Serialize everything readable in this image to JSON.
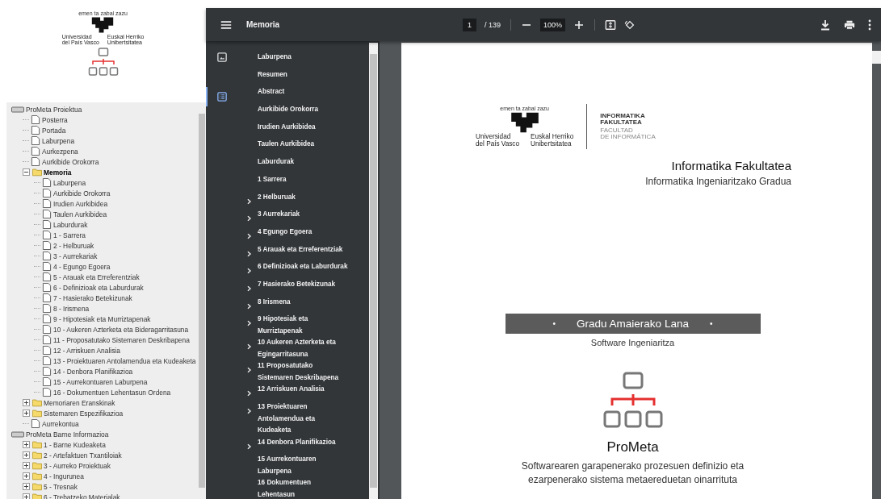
{
  "brand": {
    "motto": "emen ta zabal zazu",
    "name_es": [
      "Universidad",
      "del País Vasco"
    ],
    "name_eu": [
      "Euskal Herriko",
      "Unibertsitatea"
    ]
  },
  "tree": [
    {
      "kind": "drive",
      "label": "ProMeta Proiektua",
      "selected": false,
      "children": [
        {
          "kind": "doc",
          "label": "Posterra",
          "selected": false
        },
        {
          "kind": "doc",
          "label": "Portada",
          "selected": false
        },
        {
          "kind": "doc",
          "label": "Laburpena",
          "selected": false
        },
        {
          "kind": "doc",
          "label": "Aurkezpena",
          "selected": false
        },
        {
          "kind": "doc",
          "label": "Aurkibide Orokorra",
          "selected": false
        },
        {
          "kind": "folder",
          "label": "Memoria",
          "selected": true,
          "expanded": true,
          "children": [
            {
              "kind": "doc",
              "label": "Laburpena",
              "selected": false
            },
            {
              "kind": "doc",
              "label": "Aurkibide Orokorra",
              "selected": false
            },
            {
              "kind": "doc",
              "label": "Irudien Aurkibidea",
              "selected": false
            },
            {
              "kind": "doc",
              "label": "Taulen Aurkibidea",
              "selected": false
            },
            {
              "kind": "doc",
              "label": "Laburdurak",
              "selected": false
            },
            {
              "kind": "doc",
              "label": "1 - Sarrera",
              "selected": false
            },
            {
              "kind": "doc",
              "label": "2 - Helburuak",
              "selected": false
            },
            {
              "kind": "doc",
              "label": "3 - Aurrekariak",
              "selected": false
            },
            {
              "kind": "doc",
              "label": "4 - Egungo Egoera",
              "selected": false
            },
            {
              "kind": "doc",
              "label": "5 - Arauak eta Erreferentziak",
              "selected": false
            },
            {
              "kind": "doc",
              "label": "6 - Definizioak eta Laburdurak",
              "selected": false
            },
            {
              "kind": "doc",
              "label": "7 - Hasierako Betekizunak",
              "selected": false
            },
            {
              "kind": "doc",
              "label": "8 - Irismena",
              "selected": false
            },
            {
              "kind": "doc",
              "label": "9 - Hipotesiak eta Murriztapenak",
              "selected": false
            },
            {
              "kind": "doc",
              "label": "10 - Aukeren Azterketa eta Bideragarritasuna",
              "selected": false
            },
            {
              "kind": "doc",
              "label": "11 - Proposatutako Sistemaren Deskribapena",
              "selected": false
            },
            {
              "kind": "doc",
              "label": "12 - Arriskuen Analisia",
              "selected": false
            },
            {
              "kind": "doc",
              "label": "13 - Proiektuaren Antolamendua eta Kudeaketa",
              "selected": false
            },
            {
              "kind": "doc",
              "label": "14 - Denbora Planifikazioa",
              "selected": false
            },
            {
              "kind": "doc",
              "label": "15 - Aurrekontuaren Laburpena",
              "selected": false
            },
            {
              "kind": "doc",
              "label": "16 - Dokumentuen Lehentasun Ordena",
              "selected": false
            }
          ]
        },
        {
          "kind": "folder",
          "label": "Memoriaren Eranskinak",
          "selected": false,
          "expanded": false
        },
        {
          "kind": "folder",
          "label": "Sistemaren Espezifikazioa",
          "selected": false,
          "expanded": false
        },
        {
          "kind": "doc",
          "label": "Aurrekontua",
          "selected": false
        }
      ]
    },
    {
      "kind": "drive",
      "label": "ProMeta Barne Informazioa",
      "selected": false,
      "children": [
        {
          "kind": "folder",
          "label": "1 - Barne Kudeaketa",
          "selected": false,
          "expanded": false
        },
        {
          "kind": "folder",
          "label": "2 - Artefaktuen Txantiloiak",
          "selected": false,
          "expanded": false
        },
        {
          "kind": "folder",
          "label": "3 - Aurreko Proiektuak",
          "selected": false,
          "expanded": false
        },
        {
          "kind": "folder",
          "label": "4 - Ingurunea",
          "selected": false,
          "expanded": false
        },
        {
          "kind": "folder",
          "label": "5 - Tresnak",
          "selected": false,
          "expanded": false
        },
        {
          "kind": "folder",
          "label": "6 - Trebatzeko Materialak",
          "selected": false,
          "expanded": false
        }
      ]
    }
  ],
  "viewer": {
    "title": "Memoria",
    "page": "1",
    "page_count": "/ 139",
    "zoom": "100%",
    "side_tabs": [
      {
        "kind": "thumbnails",
        "selected": false
      },
      {
        "kind": "outline",
        "selected": true
      }
    ],
    "outline": [
      {
        "label": "Laburpena",
        "has_children": false
      },
      {
        "label": "Resumen",
        "has_children": false
      },
      {
        "label": "Abstract",
        "has_children": false
      },
      {
        "label": "Aurkibide Orokorra",
        "has_children": false
      },
      {
        "label": "Irudien Aurkibidea",
        "has_children": false
      },
      {
        "label": "Taulen Aurkibidea",
        "has_children": false
      },
      {
        "label": "Laburdurak",
        "has_children": false
      },
      {
        "label": "1 Sarrera",
        "has_children": false
      },
      {
        "label": "2 Helburuak",
        "has_children": true
      },
      {
        "label": "3 Aurrekariak",
        "has_children": true
      },
      {
        "label": "4 Egungo Egoera",
        "has_children": true
      },
      {
        "label": "5 Arauak eta Erreferentziak",
        "has_children": true
      },
      {
        "label": "6 Definizioak eta Laburdurak",
        "has_children": true
      },
      {
        "label": "7 Hasierako Betekizunak",
        "has_children": true
      },
      {
        "label": "8 Irismena",
        "has_children": true
      },
      {
        "label": "9 Hipotesiak eta Murriztapenak",
        "has_children": true
      },
      {
        "label": "10 Aukeren Azterketa eta Egingarritasuna",
        "has_children": true
      },
      {
        "label": "11 Proposatutako Sistemaren Deskribapena",
        "has_children": true
      },
      {
        "label": "12 Arriskuen Analisia",
        "has_children": true
      },
      {
        "label": "13 Proiektuaren Antolamendua eta Kudeaketa",
        "has_children": true
      },
      {
        "label": "14 Denbora Planifikazioa",
        "has_children": true
      },
      {
        "label": "15 Aurrekontuaren Laburpena",
        "has_children": false
      },
      {
        "label": "16 Dokumentuen Lehentasun",
        "has_children": false
      }
    ]
  },
  "document": {
    "logo": {
      "motto": "emen ta zabal zazu",
      "name_es": [
        "Universidad",
        "del País Vasco"
      ],
      "name_eu": [
        "Euskal Herriko",
        "Unibertsitatea"
      ]
    },
    "faculty_eu": [
      "INFORMATIKA",
      "FAKULTATEA"
    ],
    "faculty_es": [
      "FACULTAD",
      "DE INFORMÁTICA"
    ],
    "faculty": "Informatika Fakultatea",
    "degree": "Informatika Ingeniaritzako Gradua",
    "band": [
      "•",
      "Gradu Amaierako Lana",
      "•"
    ],
    "specialty": "Software Ingeniaritza",
    "project": "ProMeta",
    "subtitle": [
      "Softwarearen garapenerako prozesuen definizio eta",
      "ezarpenerako sistema metaereduetan oinarrituta"
    ]
  }
}
